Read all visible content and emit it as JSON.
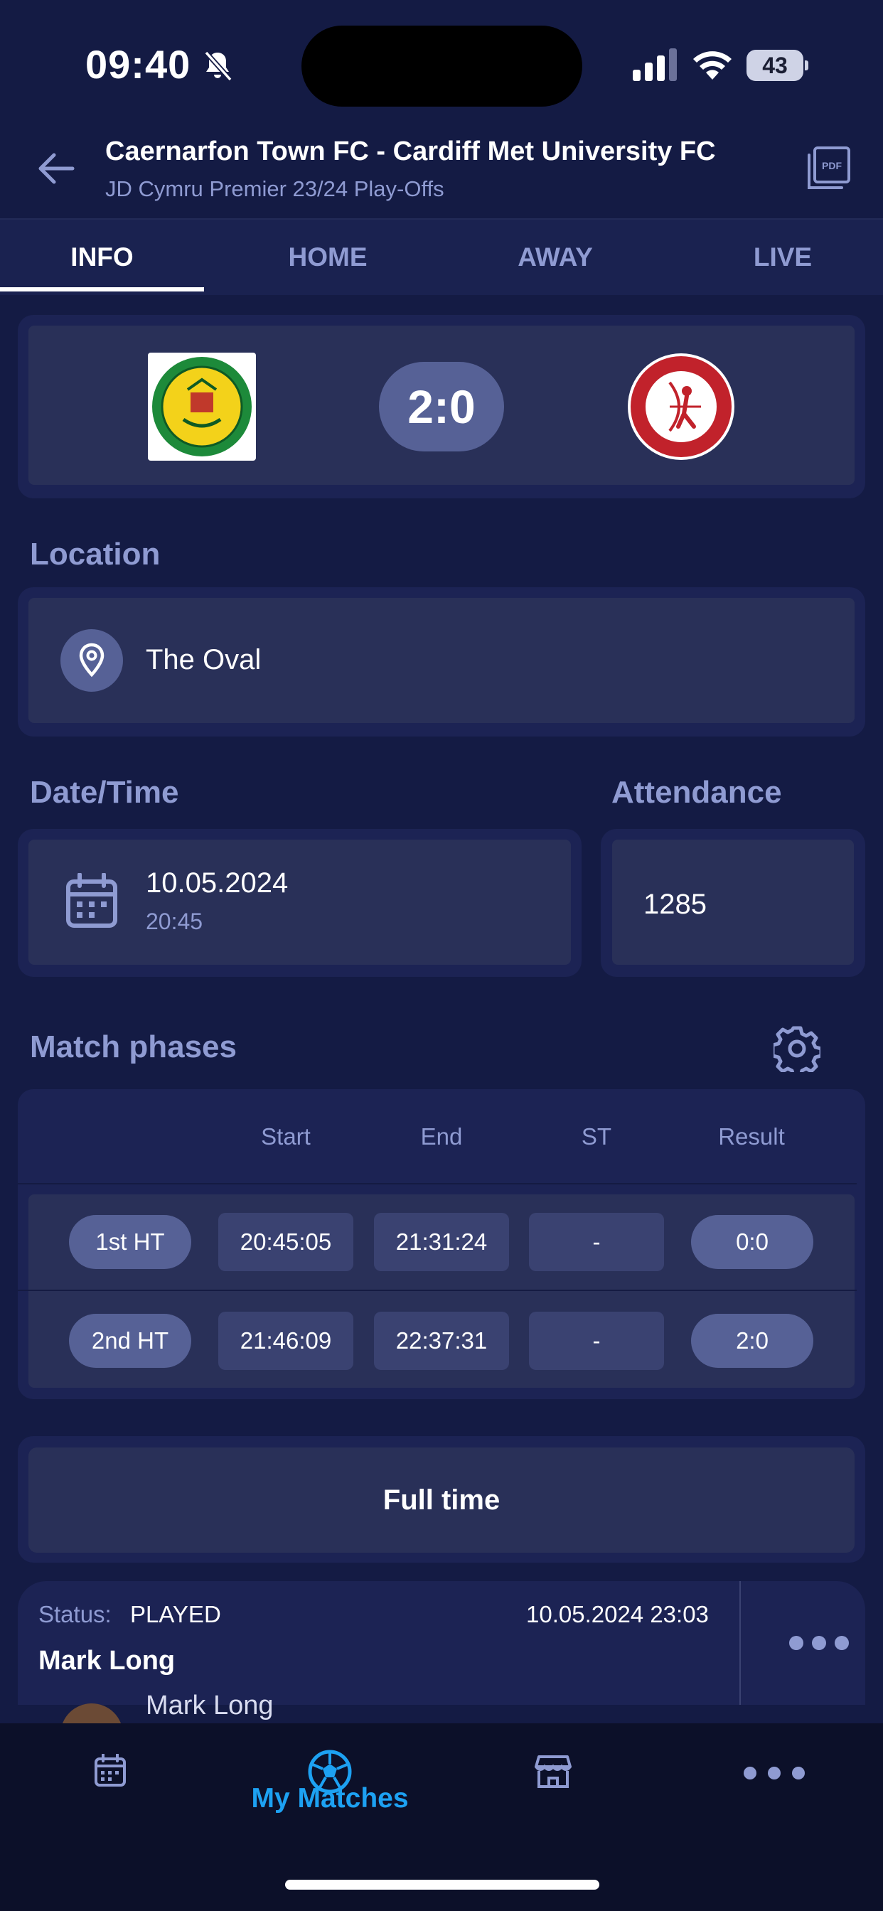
{
  "status_bar": {
    "time": "09:40",
    "battery": "43"
  },
  "header": {
    "title": "Caernarfon Town FC - Cardiff Met University FC",
    "subtitle": "JD Cymru Premier 23/24 Play-Offs"
  },
  "tabs": [
    {
      "label": "INFO",
      "active": true
    },
    {
      "label": "HOME",
      "active": false
    },
    {
      "label": "AWAY",
      "active": false
    },
    {
      "label": "LIVE",
      "active": false
    }
  ],
  "score": "2:0",
  "location": {
    "label": "Location",
    "value": "The Oval"
  },
  "datetime": {
    "label": "Date/Time",
    "date": "10.05.2024",
    "time": "20:45"
  },
  "attendance": {
    "label": "Attendance",
    "value": "1285"
  },
  "phases": {
    "label": "Match phases",
    "columns": [
      "Start",
      "End",
      "ST",
      "Result"
    ],
    "rows": [
      {
        "phase": "1st HT",
        "start": "20:45:05",
        "end": "21:31:24",
        "st": "-",
        "result": "0:0"
      },
      {
        "phase": "2nd HT",
        "start": "21:46:09",
        "end": "22:37:31",
        "st": "-",
        "result": "2:0"
      }
    ]
  },
  "full_time_button": "Full time",
  "report": {
    "status_label": "Status:",
    "status_value": "PLAYED",
    "timestamp": "10.05.2024 23:03",
    "name": "Mark Long",
    "peek_name": "Mark Long"
  },
  "bottom_nav": {
    "active_label": "My Matches",
    "accent": "#1da1f2"
  },
  "colors": {
    "background": "#141b44",
    "card": "#293058",
    "pill": "#566196",
    "muted_text": "#8f9bd2"
  }
}
